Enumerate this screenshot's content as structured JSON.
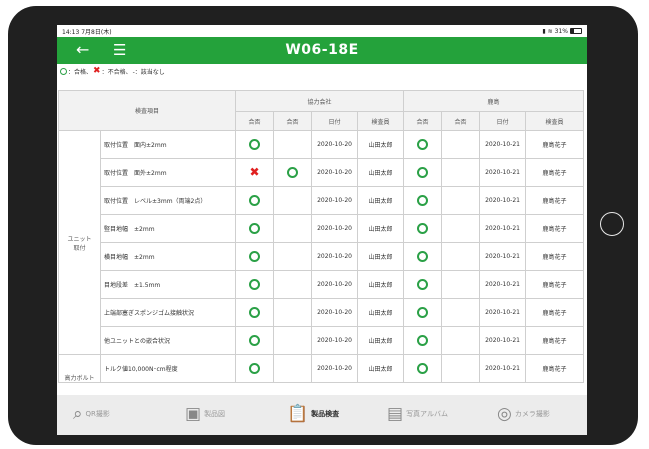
{
  "status": {
    "time": "14:13",
    "date": "7月8日(木)",
    "battery": "31%"
  },
  "header": {
    "title": "W06-18E",
    "back_icon": "arrow-left-icon",
    "menu_icon": "hamburger-menu-icon"
  },
  "legend": {
    "pass_text": "：合格、",
    "fail_text": "：不合格、",
    "na_text": "-：該当なし"
  },
  "table": {
    "item_header": "検査項目",
    "group1": "協力会社",
    "group2": "鹿島",
    "subheaders": [
      "合否",
      "合否",
      "日付",
      "検査員",
      "合否",
      "合否",
      "日付",
      "検査員"
    ],
    "section1": "ユニット\n取付",
    "section2": "高力ボルト",
    "rows": [
      {
        "item": "取付位置　面内±2mm",
        "c1": "ok",
        "c2": "",
        "date1": "2020-10-20",
        "insp1": "山田太郎",
        "k1": "ok",
        "k2": "",
        "date2": "2020-10-21",
        "insp2": "鹿島花子"
      },
      {
        "item": "取付位置　面外±2mm",
        "c1": "ng",
        "c2": "ok",
        "date1": "2020-10-20",
        "insp1": "山田太郎",
        "k1": "ok",
        "k2": "",
        "date2": "2020-10-21",
        "insp2": "鹿島花子"
      },
      {
        "item": "取付位置　レベル±3mm（両端2点）",
        "c1": "ok",
        "c2": "",
        "date1": "2020-10-20",
        "insp1": "山田太郎",
        "k1": "ok",
        "k2": "",
        "date2": "2020-10-21",
        "insp2": "鹿島花子"
      },
      {
        "item": "竪目地幅　±2mm",
        "c1": "ok",
        "c2": "",
        "date1": "2020-10-20",
        "insp1": "山田太郎",
        "k1": "ok",
        "k2": "",
        "date2": "2020-10-21",
        "insp2": "鹿島花子"
      },
      {
        "item": "横目地幅　±2mm",
        "c1": "ok",
        "c2": "",
        "date1": "2020-10-20",
        "insp1": "山田太郎",
        "k1": "ok",
        "k2": "",
        "date2": "2020-10-21",
        "insp2": "鹿島花子"
      },
      {
        "item": "目地段差　±1.5mm",
        "c1": "ok",
        "c2": "",
        "date1": "2020-10-20",
        "insp1": "山田太郎",
        "k1": "ok",
        "k2": "",
        "date2": "2020-10-21",
        "insp2": "鹿島花子"
      },
      {
        "item": "上端部塞ぎスポンジゴム接触状況",
        "c1": "ok",
        "c2": "",
        "date1": "2020-10-20",
        "insp1": "山田太郎",
        "k1": "ok",
        "k2": "",
        "date2": "2020-10-21",
        "insp2": "鹿島花子"
      },
      {
        "item": "他ユニットとの嵌合状況",
        "c1": "ok",
        "c2": "",
        "date1": "2020-10-20",
        "insp1": "山田太郎",
        "k1": "ok",
        "k2": "",
        "date2": "2020-10-21",
        "insp2": "鹿島花子"
      },
      {
        "item": "トルク値10,000N･cm程度",
        "c1": "ok",
        "c2": "",
        "date1": "2020-10-20",
        "insp1": "山田太郎",
        "k1": "ok",
        "k2": "",
        "date2": "2020-10-21",
        "insp2": "鹿島花子"
      }
    ]
  },
  "nav": [
    {
      "label": "QR撮影",
      "icon": "qr-search-icon"
    },
    {
      "label": "製品図",
      "icon": "drawing-icon"
    },
    {
      "label": "製品検査",
      "icon": "clipboard-check-icon",
      "active": true
    },
    {
      "label": "写真アルバム",
      "icon": "photo-album-icon"
    },
    {
      "label": "カメラ撮影",
      "icon": "camera-icon"
    }
  ],
  "colors": {
    "accent": "#24a23b",
    "pass": "#2aa046",
    "fail": "#e02020"
  }
}
